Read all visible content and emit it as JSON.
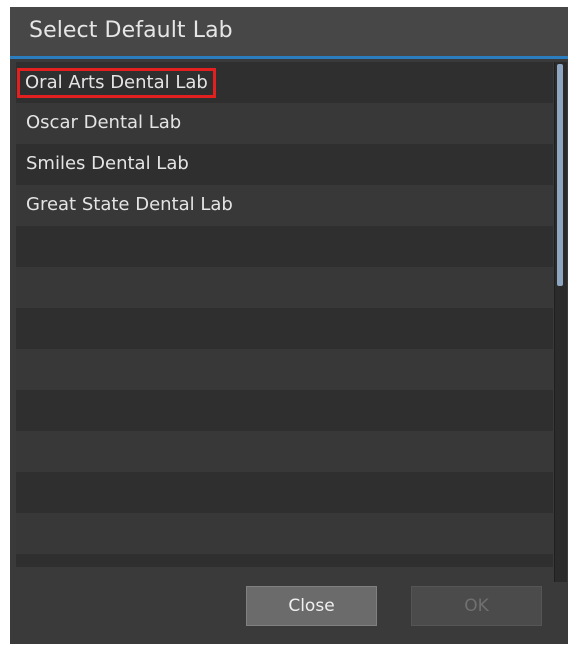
{
  "dialog": {
    "title": "Select Default Lab"
  },
  "labs": [
    {
      "label": "Oral Arts Dental Lab",
      "selected": true
    },
    {
      "label": "Oscar Dental Lab",
      "selected": false
    },
    {
      "label": "Smiles Dental Lab",
      "selected": false
    },
    {
      "label": "Great State Dental Lab",
      "selected": false
    }
  ],
  "buttons": {
    "close_label": "Close",
    "ok_label": "OK",
    "ok_enabled": false
  },
  "colors": {
    "accent": "#2a7ec0",
    "highlight_border": "#e32020",
    "background": "#3a3a3a"
  }
}
